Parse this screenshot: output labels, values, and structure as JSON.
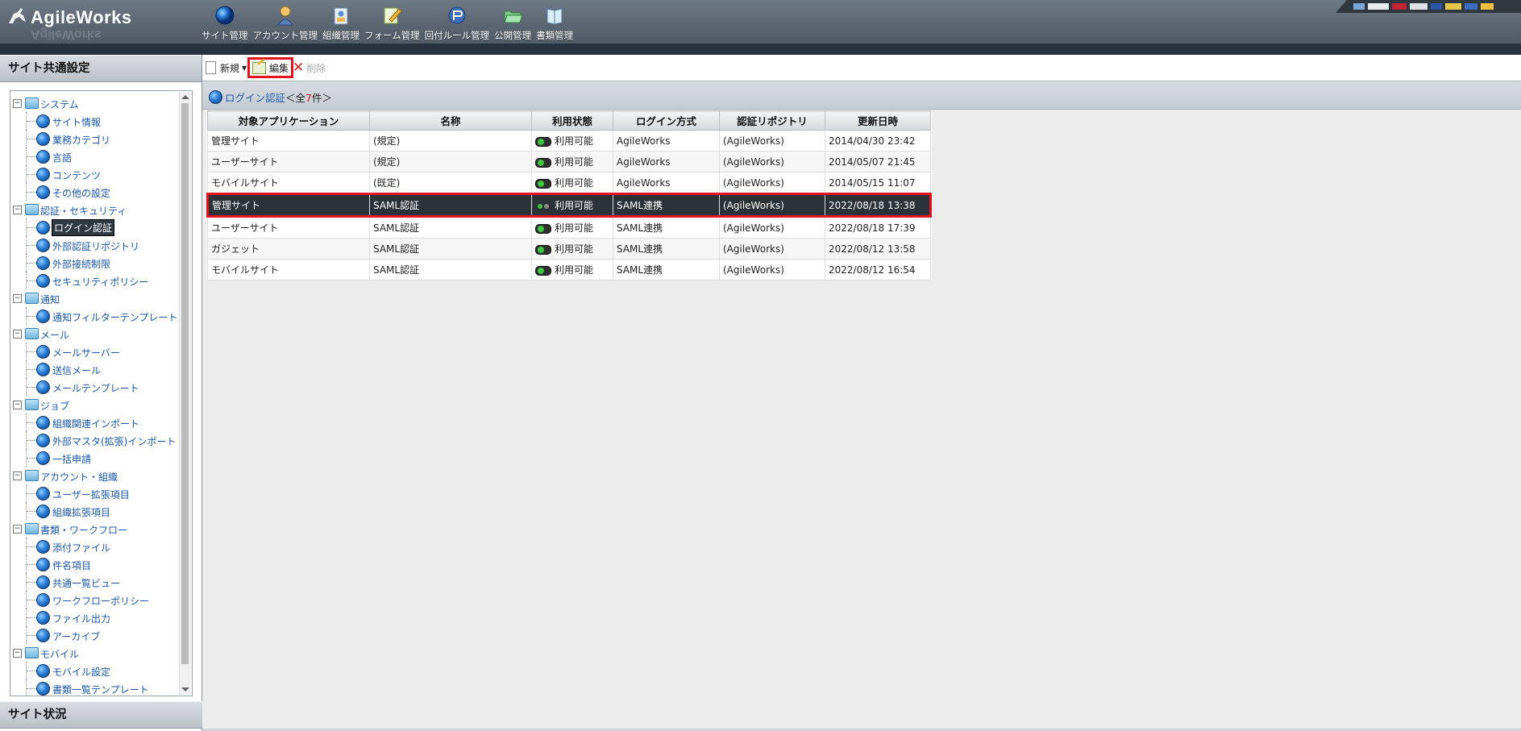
{
  "app": {
    "logo_text": "AgileWorks"
  },
  "menu": [
    {
      "label": "サイト管理",
      "icon": "globe-icon"
    },
    {
      "label": "アカウント管理",
      "icon": "person-icon"
    },
    {
      "label": "組織管理",
      "icon": "org-icon"
    },
    {
      "label": "フォーム管理",
      "icon": "form-edit-icon"
    },
    {
      "label": "回付ルール管理",
      "icon": "route-icon"
    },
    {
      "label": "公開管理",
      "icon": "folder-open-icon"
    },
    {
      "label": "書類管理",
      "icon": "book-icon"
    }
  ],
  "left_panel": {
    "title": "サイト共通設定",
    "status_title": "サイト状況",
    "tree": [
      {
        "type": "folder",
        "label": "システム"
      },
      {
        "type": "leaf",
        "label": "サイト情報"
      },
      {
        "type": "leaf",
        "label": "業務カテゴリ"
      },
      {
        "type": "leaf",
        "label": "言語"
      },
      {
        "type": "leaf",
        "label": "コンテンツ"
      },
      {
        "type": "leaf",
        "label": "その他の設定"
      },
      {
        "type": "folder",
        "label": "認証・セキュリティ"
      },
      {
        "type": "leaf",
        "label": "ログイン認証",
        "selected": true
      },
      {
        "type": "leaf",
        "label": "外部認証リポジトリ"
      },
      {
        "type": "leaf",
        "label": "外部接続制限"
      },
      {
        "type": "leaf",
        "label": "セキュリティポリシー"
      },
      {
        "type": "folder",
        "label": "通知"
      },
      {
        "type": "leaf",
        "label": "通知フィルターテンプレート"
      },
      {
        "type": "folder",
        "label": "メール"
      },
      {
        "type": "leaf",
        "label": "メールサーバー"
      },
      {
        "type": "leaf",
        "label": "送信メール"
      },
      {
        "type": "leaf",
        "label": "メールテンプレート"
      },
      {
        "type": "folder",
        "label": "ジョブ"
      },
      {
        "type": "leaf",
        "label": "組織関連インポート"
      },
      {
        "type": "leaf",
        "label": "外部マスタ(拡張)インポート"
      },
      {
        "type": "leaf",
        "label": "一括申請"
      },
      {
        "type": "folder",
        "label": "アカウント・組織"
      },
      {
        "type": "leaf",
        "label": "ユーザー拡張項目"
      },
      {
        "type": "leaf",
        "label": "組織拡張項目"
      },
      {
        "type": "folder",
        "label": "書類・ワークフロー"
      },
      {
        "type": "leaf",
        "label": "添付ファイル"
      },
      {
        "type": "leaf",
        "label": "件名項目"
      },
      {
        "type": "leaf",
        "label": "共通一覧ビュー"
      },
      {
        "type": "leaf",
        "label": "ワークフローポリシー"
      },
      {
        "type": "leaf",
        "label": "ファイル出力"
      },
      {
        "type": "leaf",
        "label": "アーカイブ"
      },
      {
        "type": "folder",
        "label": "モバイル"
      },
      {
        "type": "leaf",
        "label": "モバイル設定"
      },
      {
        "type": "leaf",
        "label": "書類一覧テンプレート"
      }
    ]
  },
  "toolbar": {
    "new_label": "新規",
    "edit_label": "編集",
    "delete_label": "削除"
  },
  "page": {
    "title": "ログイン認証",
    "count_prefix": "＜全",
    "count_value": "7",
    "count_suffix": "件＞"
  },
  "table": {
    "columns": [
      "対象アプリケーション",
      "名称",
      "利用状態",
      "ログイン方式",
      "認証リポジトリ",
      "更新日時"
    ],
    "rows": [
      {
        "app": "管理サイト",
        "name": "(規定)",
        "status": "利用可能",
        "method": "AgileWorks",
        "repo": "(AgileWorks)",
        "updated": "2014/04/30 23:42"
      },
      {
        "app": "ユーザーサイト",
        "name": "(規定)",
        "status": "利用可能",
        "method": "AgileWorks",
        "repo": "(AgileWorks)",
        "updated": "2014/05/07 21:45"
      },
      {
        "app": "モバイルサイト",
        "name": "(既定)",
        "status": "利用可能",
        "method": "AgileWorks",
        "repo": "(AgileWorks)",
        "updated": "2014/05/15 11:07"
      },
      {
        "app": "管理サイト",
        "name": "SAML認証",
        "status": "利用可能",
        "method": "SAML連携",
        "repo": "(AgileWorks)",
        "updated": "2022/08/18 13:38",
        "selected": true
      },
      {
        "app": "ユーザーサイト",
        "name": "SAML認証",
        "status": "利用可能",
        "method": "SAML連携",
        "repo": "(AgileWorks)",
        "updated": "2022/08/18 17:39"
      },
      {
        "app": "ガジェット",
        "name": "SAML認証",
        "status": "利用可能",
        "method": "SAML連携",
        "repo": "(AgileWorks)",
        "updated": "2022/08/12 13:58"
      },
      {
        "app": "モバイルサイト",
        "name": "SAML認証",
        "status": "利用可能",
        "method": "SAML連携",
        "repo": "(AgileWorks)",
        "updated": "2022/08/12 16:54"
      }
    ]
  },
  "colors": {
    "accent_red": "#e2151f",
    "link_blue": "#1b5aa8",
    "header_dark": "#27323c",
    "status_green": "#3ec43e"
  }
}
